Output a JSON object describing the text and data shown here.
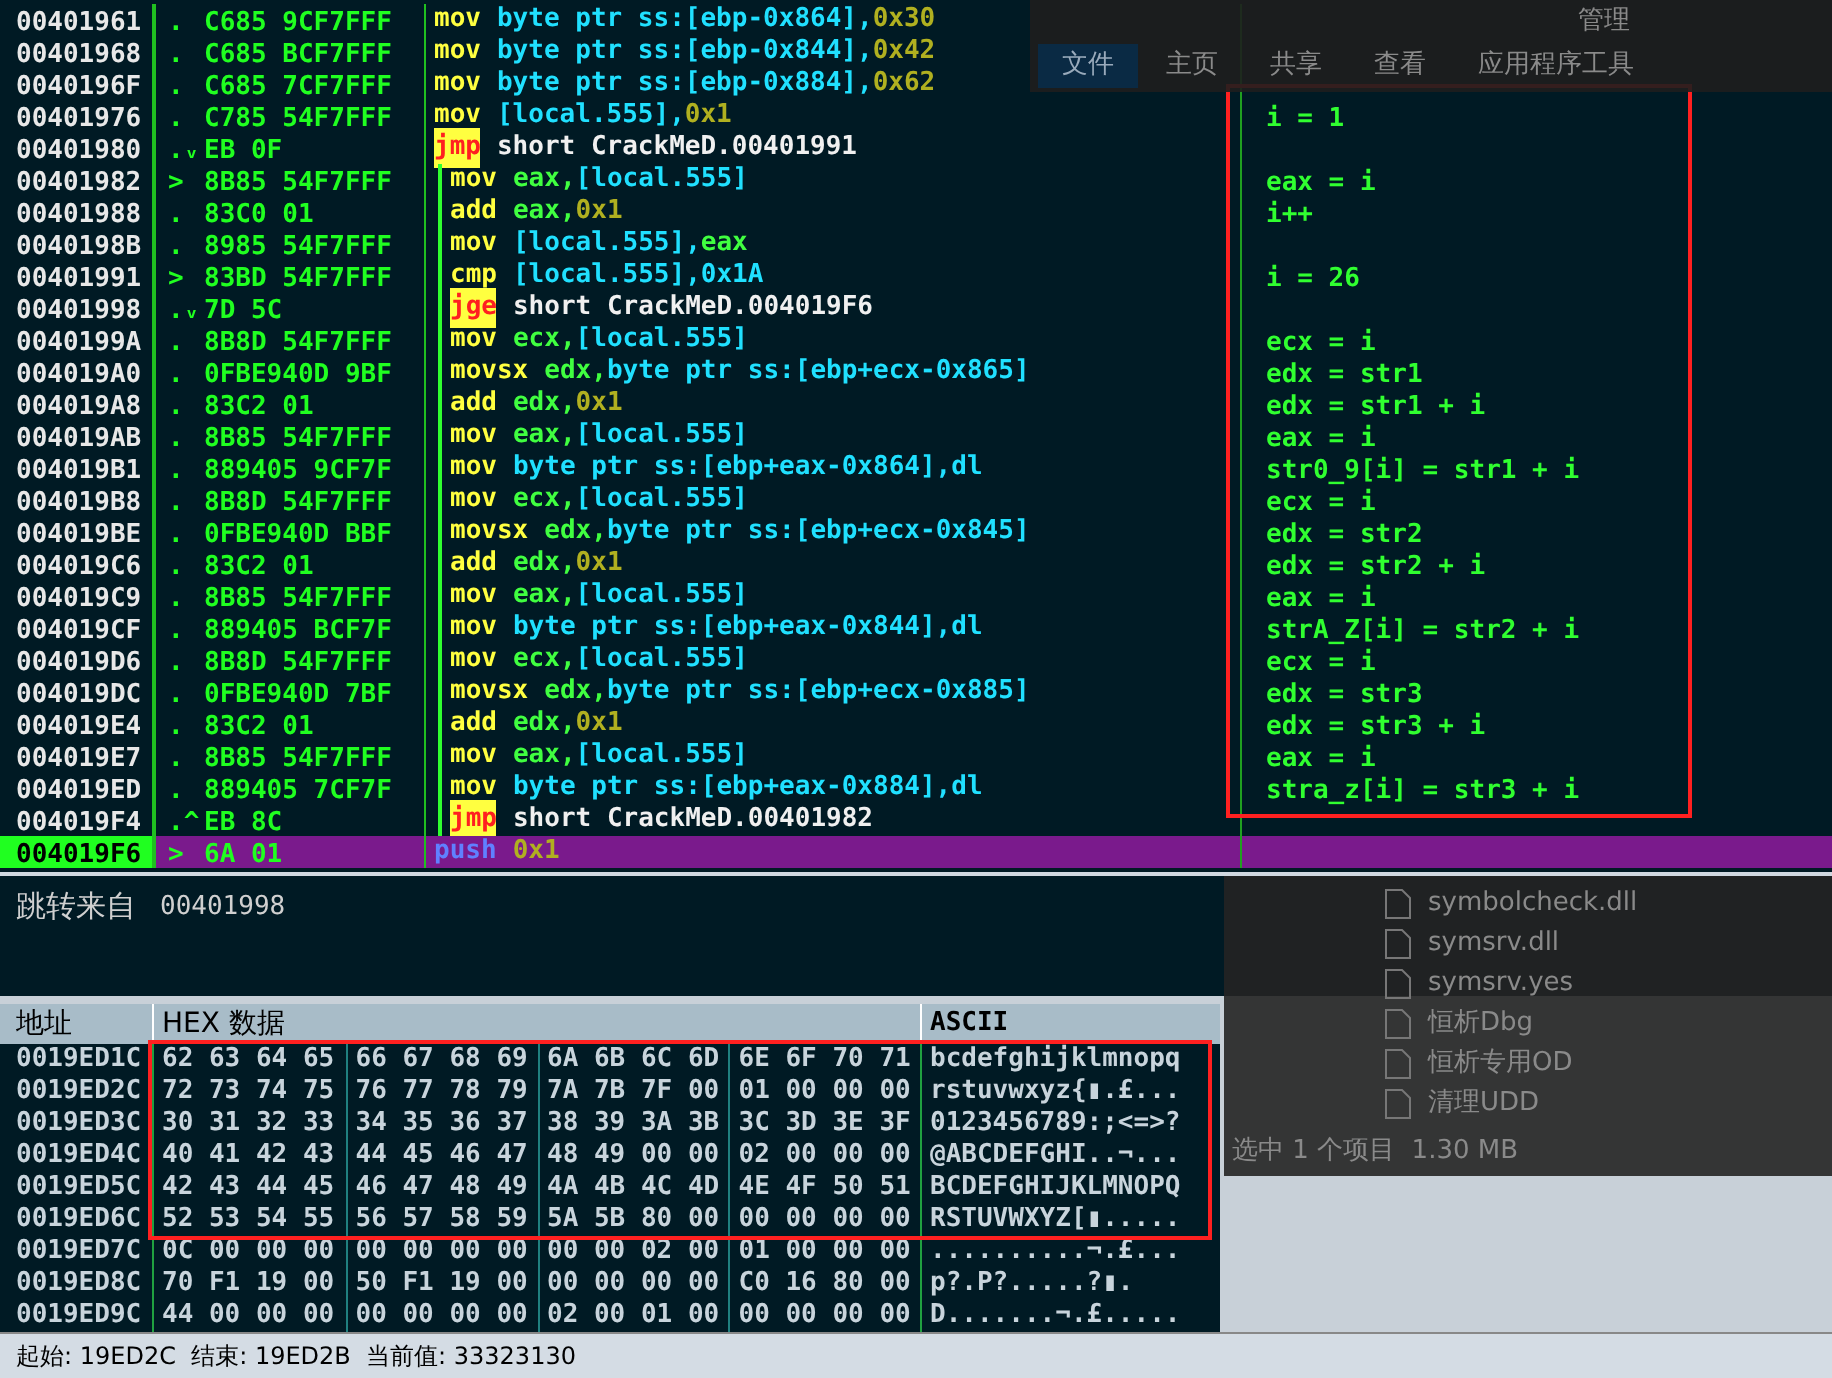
{
  "disassembly": {
    "rows": [
      {
        "address": "00401961",
        "mark": ".",
        "bytes": "C685 9CF7FFF",
        "loop": false,
        "current": false,
        "instruction": [
          {
            "kind": "mn",
            "t": "mov"
          },
          {
            "kind": "mem",
            "t": "byte ptr ss:[ebp-0x864],"
          },
          {
            "kind": "imm",
            "t": "0x30"
          }
        ]
      },
      {
        "address": "00401968",
        "mark": ".",
        "bytes": "C685 BCF7FFF",
        "loop": false,
        "current": false,
        "instruction": [
          {
            "kind": "mn",
            "t": "mov"
          },
          {
            "kind": "mem",
            "t": "byte ptr ss:[ebp-0x844],"
          },
          {
            "kind": "imm",
            "t": "0x42"
          }
        ]
      },
      {
        "address": "0040196F",
        "mark": ".",
        "bytes": "C685 7CF7FFF",
        "loop": false,
        "current": false,
        "instruction": [
          {
            "kind": "mn",
            "t": "mov"
          },
          {
            "kind": "mem",
            "t": "byte ptr ss:[ebp-0x884],"
          },
          {
            "kind": "imm",
            "t": "0x62"
          }
        ]
      },
      {
        "address": "00401976",
        "mark": ".",
        "bytes": "C785 54F7FFF",
        "loop": false,
        "current": false,
        "comment": "i = 1",
        "instruction": [
          {
            "kind": "mn",
            "t": "mov"
          },
          {
            "kind": "mem",
            "t": "[local.555],"
          },
          {
            "kind": "imm",
            "t": "0x1"
          }
        ]
      },
      {
        "address": "00401980",
        "mark": ".ᵥ",
        "bytes": "EB 0F",
        "loop": false,
        "current": false,
        "instruction": [
          {
            "kind": "jmn",
            "t": "jmp"
          },
          {
            "kind": "lbl",
            "t": "short CrackMeD.00401991"
          }
        ]
      },
      {
        "address": "00401982",
        "mark": ">",
        "bytes": "8B85 54F7FFF",
        "loop": true,
        "current": false,
        "comment": "eax = i",
        "instruction": [
          {
            "kind": "mn",
            "t": "mov"
          },
          {
            "kind": "reg",
            "t": "eax,"
          },
          {
            "kind": "mem",
            "t": "[local.555]"
          }
        ]
      },
      {
        "address": "00401988",
        "mark": ".",
        "bytes": "83C0 01",
        "loop": true,
        "current": false,
        "comment": "i++",
        "instruction": [
          {
            "kind": "mn",
            "t": "add"
          },
          {
            "kind": "reg",
            "t": "eax,"
          },
          {
            "kind": "imm",
            "t": "0x1"
          }
        ]
      },
      {
        "address": "0040198B",
        "mark": ".",
        "bytes": "8985 54F7FFF",
        "loop": true,
        "current": false,
        "instruction": [
          {
            "kind": "mn",
            "t": "mov"
          },
          {
            "kind": "mem",
            "t": "[local.555],"
          },
          {
            "kind": "reg",
            "t": "eax"
          }
        ]
      },
      {
        "address": "00401991",
        "mark": ">",
        "bytes": "83BD 54F7FFF",
        "loop": true,
        "current": false,
        "comment": "i = 26",
        "instruction": [
          {
            "kind": "mn",
            "t": "cmp"
          },
          {
            "kind": "mem",
            "t": "[local.555],0x1A"
          }
        ]
      },
      {
        "address": "00401998",
        "mark": ".ᵥ",
        "bytes": "7D 5C",
        "loop": true,
        "current": false,
        "instruction": [
          {
            "kind": "jmn",
            "t": "jge"
          },
          {
            "kind": "lbl",
            "t": "short CrackMeD.004019F6"
          }
        ]
      },
      {
        "address": "0040199A",
        "mark": ".",
        "bytes": "8B8D 54F7FFF",
        "loop": true,
        "current": false,
        "comment": "ecx = i",
        "instruction": [
          {
            "kind": "mn",
            "t": "mov"
          },
          {
            "kind": "reg",
            "t": "ecx,"
          },
          {
            "kind": "mem",
            "t": "[local.555]"
          }
        ]
      },
      {
        "address": "004019A0",
        "mark": ".",
        "bytes": "0FBE940D 9BF",
        "loop": true,
        "current": false,
        "comment": "edx = str1",
        "instruction": [
          {
            "kind": "mn",
            "t": "movsx"
          },
          {
            "kind": "reg",
            "t": "edx,"
          },
          {
            "kind": "mem",
            "t": "byte ptr ss:[ebp+ecx-0x865]"
          }
        ]
      },
      {
        "address": "004019A8",
        "mark": ".",
        "bytes": "83C2 01",
        "loop": true,
        "current": false,
        "comment": "edx = str1 + i",
        "instruction": [
          {
            "kind": "mn",
            "t": "add"
          },
          {
            "kind": "reg",
            "t": "edx,"
          },
          {
            "kind": "imm",
            "t": "0x1"
          }
        ]
      },
      {
        "address": "004019AB",
        "mark": ".",
        "bytes": "8B85 54F7FFF",
        "loop": true,
        "current": false,
        "comment": "eax = i",
        "instruction": [
          {
            "kind": "mn",
            "t": "mov"
          },
          {
            "kind": "reg",
            "t": "eax,"
          },
          {
            "kind": "mem",
            "t": "[local.555]"
          }
        ]
      },
      {
        "address": "004019B1",
        "mark": ".",
        "bytes": "889405 9CF7F",
        "loop": true,
        "current": false,
        "comment": "str0_9[i] = str1 + i",
        "instruction": [
          {
            "kind": "mn",
            "t": "mov"
          },
          {
            "kind": "mem",
            "t": "byte ptr ss:[ebp+eax-0x864],dl"
          }
        ]
      },
      {
        "address": "004019B8",
        "mark": ".",
        "bytes": "8B8D 54F7FFF",
        "loop": true,
        "current": false,
        "comment": "ecx = i",
        "instruction": [
          {
            "kind": "mn",
            "t": "mov"
          },
          {
            "kind": "reg",
            "t": "ecx,"
          },
          {
            "kind": "mem",
            "t": "[local.555]"
          }
        ]
      },
      {
        "address": "004019BE",
        "mark": ".",
        "bytes": "0FBE940D BBF",
        "loop": true,
        "current": false,
        "comment": "edx = str2",
        "instruction": [
          {
            "kind": "mn",
            "t": "movsx"
          },
          {
            "kind": "reg",
            "t": "edx,"
          },
          {
            "kind": "mem",
            "t": "byte ptr ss:[ebp+ecx-0x845]"
          }
        ]
      },
      {
        "address": "004019C6",
        "mark": ".",
        "bytes": "83C2 01",
        "loop": true,
        "current": false,
        "comment": "edx = str2 + i",
        "instruction": [
          {
            "kind": "mn",
            "t": "add"
          },
          {
            "kind": "reg",
            "t": "edx,"
          },
          {
            "kind": "imm",
            "t": "0x1"
          }
        ]
      },
      {
        "address": "004019C9",
        "mark": ".",
        "bytes": "8B85 54F7FFF",
        "loop": true,
        "current": false,
        "comment": "eax = i",
        "instruction": [
          {
            "kind": "mn",
            "t": "mov"
          },
          {
            "kind": "reg",
            "t": "eax,"
          },
          {
            "kind": "mem",
            "t": "[local.555]"
          }
        ]
      },
      {
        "address": "004019CF",
        "mark": ".",
        "bytes": "889405 BCF7F",
        "loop": true,
        "current": false,
        "comment": "strA_Z[i] = str2 + i",
        "instruction": [
          {
            "kind": "mn",
            "t": "mov"
          },
          {
            "kind": "mem",
            "t": "byte ptr ss:[ebp+eax-0x844],dl"
          }
        ]
      },
      {
        "address": "004019D6",
        "mark": ".",
        "bytes": "8B8D 54F7FFF",
        "loop": true,
        "current": false,
        "comment": "ecx = i",
        "instruction": [
          {
            "kind": "mn",
            "t": "mov"
          },
          {
            "kind": "reg",
            "t": "ecx,"
          },
          {
            "kind": "mem",
            "t": "[local.555]"
          }
        ]
      },
      {
        "address": "004019DC",
        "mark": ".",
        "bytes": "0FBE940D 7BF",
        "loop": true,
        "current": false,
        "comment": "edx = str3",
        "instruction": [
          {
            "kind": "mn",
            "t": "movsx"
          },
          {
            "kind": "reg",
            "t": "edx,"
          },
          {
            "kind": "mem",
            "t": "byte ptr ss:[ebp+ecx-0x885]"
          }
        ]
      },
      {
        "address": "004019E4",
        "mark": ".",
        "bytes": "83C2 01",
        "loop": true,
        "current": false,
        "comment": "edx = str3 + i",
        "instruction": [
          {
            "kind": "mn",
            "t": "add"
          },
          {
            "kind": "reg",
            "t": "edx,"
          },
          {
            "kind": "imm",
            "t": "0x1"
          }
        ]
      },
      {
        "address": "004019E7",
        "mark": ".",
        "bytes": "8B85 54F7FFF",
        "loop": true,
        "current": false,
        "comment": "eax = i",
        "instruction": [
          {
            "kind": "mn",
            "t": "mov"
          },
          {
            "kind": "reg",
            "t": "eax,"
          },
          {
            "kind": "mem",
            "t": "[local.555]"
          }
        ]
      },
      {
        "address": "004019ED",
        "mark": ".",
        "bytes": "889405 7CF7F",
        "loop": true,
        "current": false,
        "comment": "stra_z[i] = str3 + i",
        "instruction": [
          {
            "kind": "mn",
            "t": "mov"
          },
          {
            "kind": "mem",
            "t": "byte ptr ss:[ebp+eax-0x884],dl"
          }
        ]
      },
      {
        "address": "004019F4",
        "mark": ".^",
        "bytes": "EB 8C",
        "loop": true,
        "current": false,
        "instruction": [
          {
            "kind": "jmn",
            "t": "jmp"
          },
          {
            "kind": "lbl",
            "t": "short CrackMeD.00401982"
          }
        ]
      },
      {
        "address": "004019F6",
        "mark": ">",
        "bytes": "6A 01",
        "loop": false,
        "current": true,
        "instruction": [
          {
            "kind": "push",
            "t": "push"
          },
          {
            "kind": "imm",
            "t": "0x1"
          }
        ]
      }
    ]
  },
  "jump_info": {
    "label": "跳转来自",
    "address": "00401998"
  },
  "hex_dump": {
    "columns": [
      "地址",
      "HEX 数据",
      "ASCII"
    ],
    "rows": [
      {
        "address": "0019ED1C",
        "groups": [
          "62 63 64 65",
          "66 67 68 69",
          "6A 6B 6C 6D",
          "6E 6F 70 71"
        ],
        "ascii": "bcdefghijklmnopq",
        "boxed": true
      },
      {
        "address": "0019ED2C",
        "groups": [
          "72 73 74 75",
          "76 77 78 79",
          "7A 7B 7F 00",
          "01 00 00 00"
        ],
        "ascii": "rstuvwxyz{▮.£...",
        "boxed": true
      },
      {
        "address": "0019ED3C",
        "groups": [
          "30 31 32 33",
          "34 35 36 37",
          "38 39 3A 3B",
          "3C 3D 3E 3F"
        ],
        "ascii": "0123456789:;<=>?",
        "boxed": true
      },
      {
        "address": "0019ED4C",
        "groups": [
          "40 41 42 43",
          "44 45 46 47",
          "48 49 00 00",
          "02 00 00 00"
        ],
        "ascii": "@ABCDEFGHI..¬...",
        "boxed": true
      },
      {
        "address": "0019ED5C",
        "groups": [
          "42 43 44 45",
          "46 47 48 49",
          "4A 4B 4C 4D",
          "4E 4F 50 51"
        ],
        "ascii": "BCDEFGHIJKLMNOPQ",
        "boxed": true
      },
      {
        "address": "0019ED6C",
        "groups": [
          "52 53 54 55",
          "56 57 58 59",
          "5A 5B 80 00",
          "00 00 00 00"
        ],
        "ascii": "RSTUVWXYZ[▮.....",
        "boxed": true
      },
      {
        "address": "0019ED7C",
        "groups": [
          "0C 00 00 00",
          "00 00 00 00",
          "00 00 02 00",
          "01 00 00 00"
        ],
        "ascii": "..........¬.£...",
        "boxed": false
      },
      {
        "address": "0019ED8C",
        "groups": [
          "70 F1 19 00",
          "50 F1 19 00",
          "00 00 00 00",
          "C0 16 80 00"
        ],
        "ascii": "p?.P?.....?▮.",
        "boxed": false
      },
      {
        "address": "0019ED9C",
        "groups": [
          "44 00 00 00",
          "00 00 00 00",
          "02 00 01 00",
          "00 00 00 00"
        ],
        "ascii": "D.......¬.£.....",
        "boxed": false
      }
    ]
  },
  "status_bar": "起始: 19ED2C  结束: 19ED2B  当前值: 33323130",
  "explorer": {
    "ribbon_title": "管理",
    "tabs": [
      {
        "label": "文件",
        "selected": true
      },
      {
        "label": "主页",
        "selected": false
      },
      {
        "label": "共享",
        "selected": false
      },
      {
        "label": "查看",
        "selected": false
      },
      {
        "label": "应用程序工具",
        "selected": false
      }
    ],
    "files": [
      "symbolcheck.dll",
      "symsrv.dll",
      "symsrv.yes",
      "恒析Dbg",
      "恒析专用OD",
      "清理UDD"
    ],
    "status": "选中 1 个项目  1.30 MB"
  }
}
